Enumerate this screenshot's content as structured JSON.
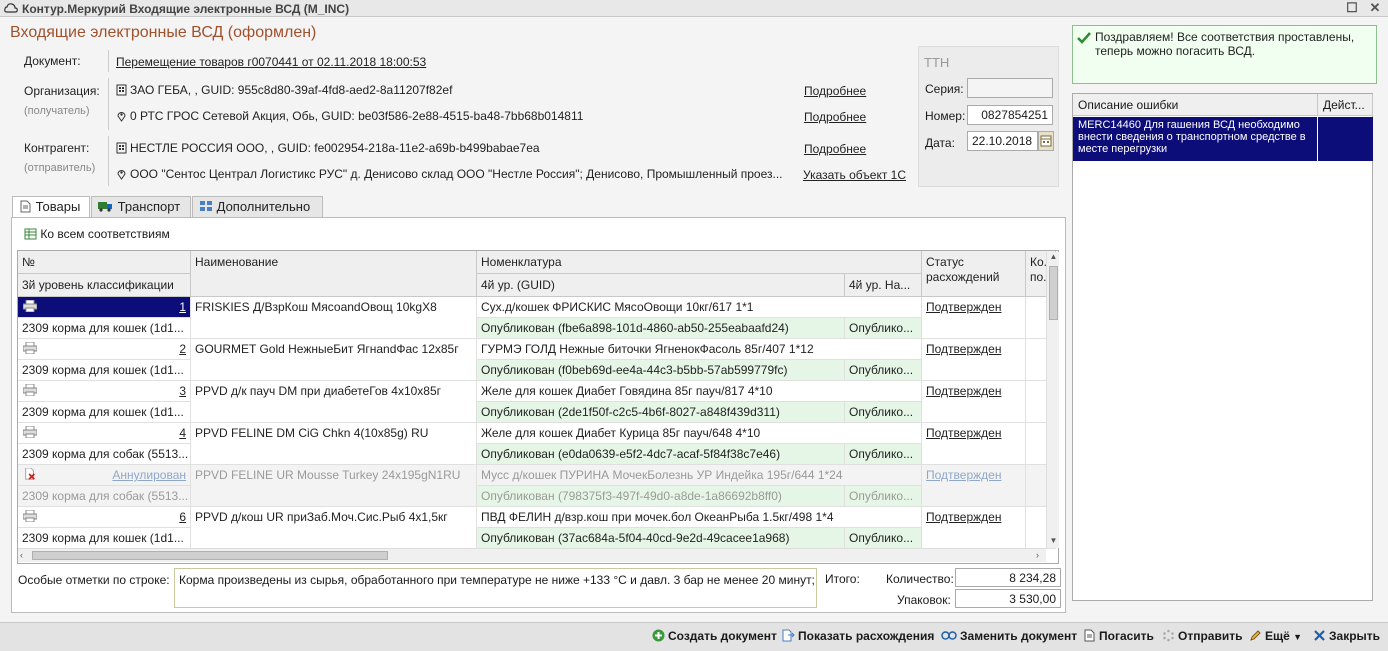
{
  "window": {
    "title": "Контур.Меркурий Входящие электронные ВСД (M_INC)"
  },
  "header": {
    "title": "Входящие электронные ВСД (оформлен)"
  },
  "document": {
    "label": "Документ:",
    "value": "Перемещение товаров г0070441 от 02.11.2018 18:00:53"
  },
  "organization": {
    "label": "Организация:",
    "sublabel": "(получатель)",
    "line1": "ЗАО ГЕБА, , GUID: 955c8d80-39af-4fd8-aed2-8a11207f82ef",
    "line2": "0 РТС ГРОС Сетевой Акция, Обь, GUID: be03f586-2e88-4515-ba48-7bb68b014811",
    "more1": "Подробнее",
    "more2": "Подробнее"
  },
  "counterparty": {
    "label": "Контрагент:",
    "sublabel": "(отправитель)",
    "line1": "НЕСТЛЕ РОССИЯ ООО, , GUID: fe002954-218a-11e2-a69b-b499babae7ea",
    "line2": "ООО \"Сентос Централ Логистикс РУС\" д. Денисово склад ООО \"Нестле Россия\"; Денисово, Промышленный проез...",
    "more1": "Подробнее",
    "link2": "Указать объект 1С"
  },
  "ttn": {
    "title": "ТТН",
    "series_label": "Серия:",
    "series_value": "",
    "number_label": "Номер:",
    "number_value": "0827854251",
    "date_label": "Дата:",
    "date_value": "22.10.2018"
  },
  "tabs": [
    "Товары",
    "Транспорт",
    "Дополнительно"
  ],
  "toolbar": {
    "all_matches": "Ко всем соответствиям"
  },
  "grid": {
    "headers": {
      "num": "№",
      "level3": "3й уровень классификации",
      "name": "Наименование",
      "nomenclature": "Номенклатура",
      "level4guid": "4й ур. (GUID)",
      "level4name": "4й ур. На...",
      "status": "Статус",
      "status2": "расхождений",
      "qty": "Ко...",
      "qty2": "по..."
    },
    "rows": [
      {
        "num": "1",
        "level3": "2309 корма для кошек (1d1...",
        "name": "FRISKIES Д/ВзрКош МясоandОвощ 10kgX8",
        "nom": "Сух.д/кошек ФРИСКИС МясоОвощи 10кг/617 1*1",
        "guid": "Опубликован (fbe6a898-101d-4860-ab50-255eabaafd24)",
        "l4": "Опублико...",
        "status": "Подтвержден"
      },
      {
        "num": "2",
        "level3": "2309 корма для кошек (1d1...",
        "name": "GOURMET Gold НежныеБит ЯгнandФас 12x85г",
        "nom": "ГУРМЭ ГОЛД Нежные биточки ЯгненокФасоль 85г/407 1*12",
        "guid": "Опубликован (f0beb69d-ee4a-44c3-b5bb-57ab599779fc)",
        "l4": "Опублико...",
        "status": "Подтвержден"
      },
      {
        "num": "3",
        "level3": "2309 корма для кошек (1d1...",
        "name": "PPVD д/к пауч DM при диабетеГов 4x10x85г",
        "nom": "Желе для кошек Диабет Говядина 85г пауч/817 4*10",
        "guid": "Опубликован (2de1f50f-c2c5-4b6f-8027-a848f439d311)",
        "l4": "Опублико...",
        "status": "Подтвержден"
      },
      {
        "num": "4",
        "level3": "2309 корма для собак (5513...",
        "name": "PPVD FELINE DM CiG Chkn 4(10x85g) RU",
        "nom": "Желе для кошек Диабет Курица 85г пауч/648  4*10",
        "guid": "Опубликован (e0da0639-e5f2-4dc7-acaf-5f84f38c7e46)",
        "l4": "Опублико...",
        "status": "Подтвержден"
      },
      {
        "num": "Аннулирован",
        "level3": "2309 корма для собак (5513...",
        "name": "PPVD FELINE UR Mousse Turkey 24x195gN1RU",
        "nom": "Мусс д/кошек ПУРИНА МочекБолезнь УР Индейка 195г/644 1*24",
        "guid": "Опубликован (798375f3-497f-49d0-a8de-1a86692b8ff0)",
        "l4": "Опублико...",
        "status": "Подтвержден"
      },
      {
        "num": "6",
        "level3": "2309 корма для кошек (1d1...",
        "name": "PPVD д/кош UR приЗаб.Моч.Сис.Рыб 4x1,5кг",
        "nom": "ПВД ФЕЛИН д/взр.кош при мочек.бол ОкеанРыба  1.5кг/498 1*4",
        "guid": "Опубликован (37ac684a-5f04-40cd-9e2d-49cacee1a968)",
        "l4": "Опублико...",
        "status": "Подтвержден"
      }
    ]
  },
  "notes": {
    "label": "Особые отметки по строке:",
    "value": "Корма произведены из сырья, обработанного при температуре не ниже +133 °С и давл. 3 бар не менее 20 минут;;"
  },
  "totals": {
    "label": "Итого:",
    "qty_label": "Количество:",
    "qty_value": "8 234,28",
    "pkg_label": "Упаковок:",
    "pkg_value": "3 530,00"
  },
  "success": {
    "text": "Поздравляем! Все соответствия проставлены, теперь можно погасить ВСД."
  },
  "errors": {
    "col1": "Описание ошибки",
    "col2": "Дейст...",
    "row1": "MERC14460 Для гашения ВСД необходимо внести сведения о транспортном средстве в месте перегрузки"
  },
  "actions": {
    "create": "Создать документ",
    "show_diff": "Показать расхождения",
    "replace": "Заменить документ",
    "redeem": "Погасить",
    "send": "Отправить",
    "more": "Ещё",
    "close": "Закрыть"
  }
}
